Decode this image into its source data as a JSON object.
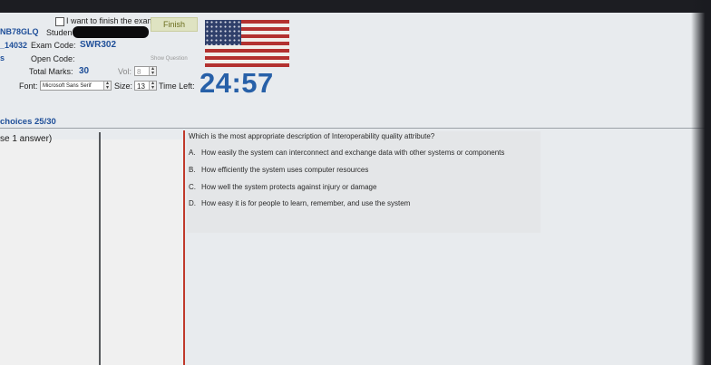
{
  "header": {
    "finish_checkbox_label": "I want to finish the exam.",
    "finish_button": "Finish",
    "id_fragment": "NB78GLQ",
    "student_label": "Studen",
    "code_fragment": "_14032",
    "exam_code_label": "Exam Code:",
    "exam_code_value": "SWR302",
    "left_edge_fragment": "s",
    "open_code_label": "Open Code:",
    "show_question_button": "Show Question",
    "total_marks_label": "Total Marks:",
    "total_marks_value": "30",
    "vol_label": "Vol:",
    "vol_value": "8",
    "font_label": "Font:",
    "font_value": "Microsoft Sans Serif",
    "size_label": "Size:",
    "size_value": "13",
    "time_left_label": "Time Left:",
    "timer": "24:57"
  },
  "progress": {
    "choices_label": "choices 25/30",
    "answer_hint": "se 1 answer)"
  },
  "question": {
    "text": "Which is the most appropriate description of Interoperability quality attribute?",
    "options": [
      {
        "letter": "A.",
        "text": "How easily the system can interconnect and exchange data with other systems or components"
      },
      {
        "letter": "B.",
        "text": "How efficiently the system uses computer resources"
      },
      {
        "letter": "C.",
        "text": "How well the system protects against injury or damage"
      },
      {
        "letter": "D.",
        "text": "How easy it is for people to learn, remember, and use the system"
      }
    ]
  },
  "colors": {
    "accent_blue": "#2760a8",
    "divider_red": "#c0392b",
    "finish_button_bg": "#dfe3c2"
  },
  "icons": [
    "flag-icon",
    "checkbox-icon",
    "spinner-arrows-icon"
  ]
}
